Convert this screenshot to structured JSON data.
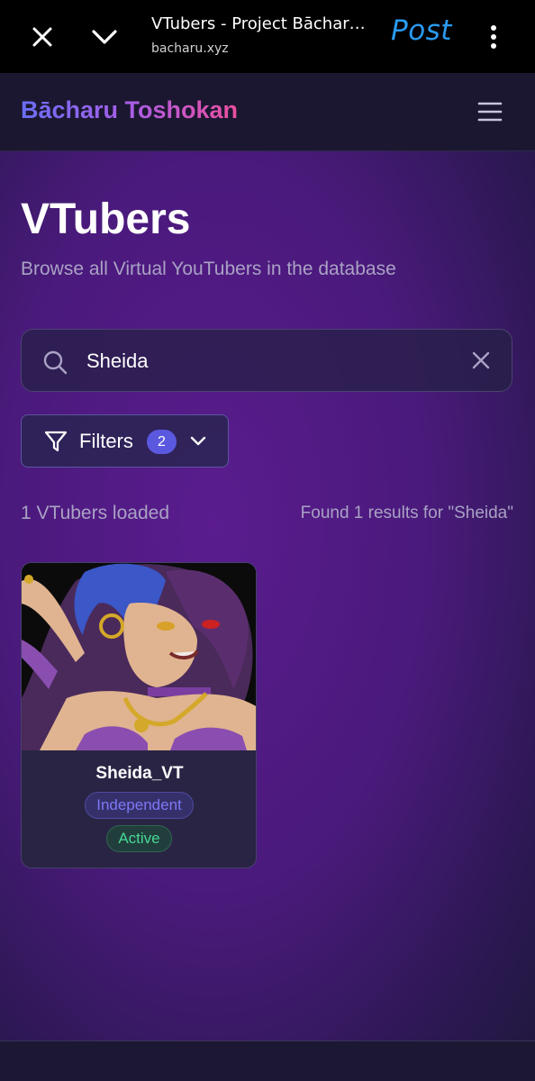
{
  "browser": {
    "tab_title": "VTubers - Project Bācharu …",
    "url": "bacharu.xyz",
    "post_label": "Post",
    "icons": [
      "close-icon",
      "chevron-down-icon",
      "kebab-menu-icon"
    ]
  },
  "header": {
    "brand": "Bācharu Toshokan",
    "menu_icon": "hamburger-menu-icon"
  },
  "page": {
    "title": "VTubers",
    "subtitle": "Browse all Virtual YouTubers in the database"
  },
  "search": {
    "value": "Sheida",
    "icon": "search-icon",
    "clear_icon": "close-icon"
  },
  "filters": {
    "label": "Filters",
    "active_count": "2",
    "icon": "filter-funnel-icon"
  },
  "results": {
    "loaded_text": "1 VTubers loaded",
    "found_text": "Found 1 results for \"Sheida\""
  },
  "cards": [
    {
      "name": "Sheida_VT",
      "affiliation": "Independent",
      "status": "Active"
    }
  ],
  "colors": {
    "accent": "#5b58e0",
    "active_green": "#46d796",
    "affiliation_blue": "#7d78f5",
    "post_blue": "#2a9bf0"
  }
}
